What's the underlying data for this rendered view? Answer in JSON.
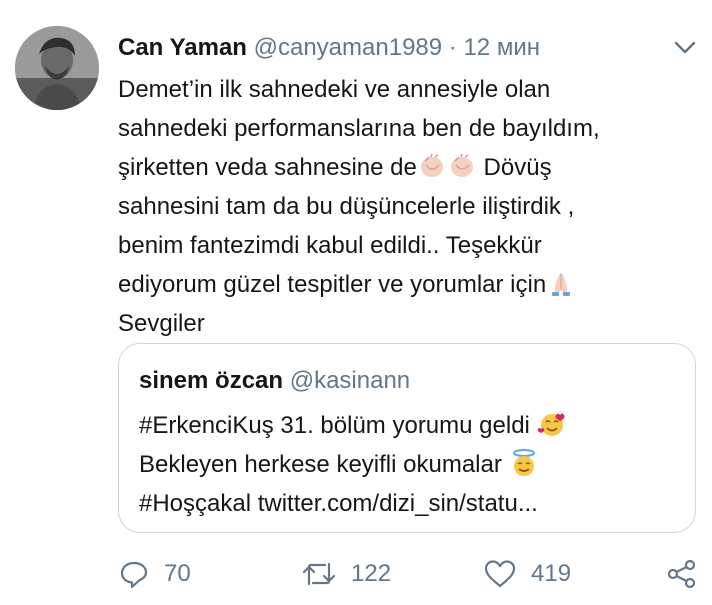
{
  "tweet": {
    "author_name": "Can Yaman",
    "author_handle": "@canyaman1989",
    "separator": "·",
    "time": "12 мин",
    "lines": [
      "Demet’in ilk sahnedeki ve annesiyle olan",
      "sahnedeki performanslarına ben de bayıldım,",
      "şirketten veda sahnesine de",
      "Dövüş",
      "sahnesini tam da bu düşüncelerle iliştirdik ,",
      "benim fantezimdi kabul edildi.. Teşekkür",
      "ediyorum güzel tespitler ve yorumlar için",
      "Sevgiler"
    ]
  },
  "quoted": {
    "name": "sinem özcan",
    "handle": "@kasinann",
    "line1": "#ErkenciKuş 31. bölüm yorumu geldi",
    "line2": "Bekleyen herkese keyifli okumalar",
    "line3": "#Hoşçakal twitter.com/dizi_sin/statu..."
  },
  "actions": {
    "replies": "70",
    "retweets": "122",
    "likes": "419"
  },
  "icons": {
    "reply": "reply-icon",
    "retweet": "retweet-icon",
    "like": "heart-icon",
    "share": "share-icon",
    "caret": "chevron-down-icon",
    "clap": "clapping-hands-emoji",
    "pray": "folded-hands-emoji",
    "hearts_face": "smiling-face-with-hearts-emoji",
    "halo_face": "smiling-face-with-halo-emoji"
  },
  "colors": {
    "text": "#14171a",
    "secondary": "#657786",
    "border": "#ccd6dd"
  }
}
